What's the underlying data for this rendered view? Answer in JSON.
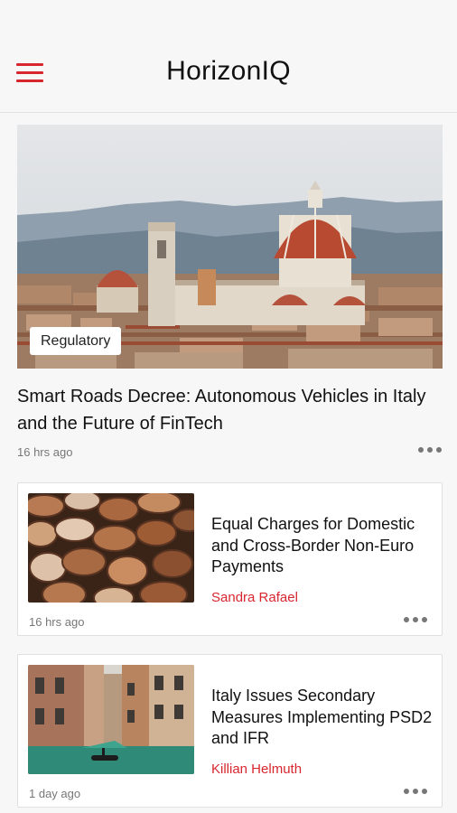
{
  "header": {
    "title": "HorizonIQ",
    "menu_icon": "hamburger-menu-icon",
    "accent": "#d8262f"
  },
  "hero": {
    "tag": "Regulatory",
    "title": "Smart Roads Decree: Autonomous Vehicles in Italy and the Future of FinTech",
    "time": "16 hrs ago",
    "more_icon": "more-options-icon"
  },
  "articles": [
    {
      "title": "Equal Charges for Domestic and Cross-Border Non-Euro Payments",
      "author": "Sandra Rafael",
      "time": "16 hrs ago"
    },
    {
      "title": "Italy Issues Secondary Measures Implementing PSD2 and IFR",
      "author": "Killian Helmuth",
      "time": "1 day ago"
    }
  ]
}
